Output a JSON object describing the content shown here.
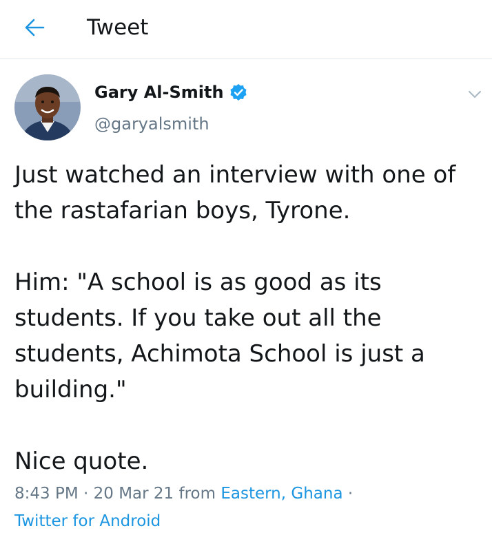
{
  "header": {
    "title": "Tweet",
    "back_icon": "arrow-left-icon"
  },
  "author": {
    "name": "Gary Al-Smith",
    "handle": "@garyalsmith",
    "verified_icon": "verified-badge-icon",
    "menu_icon": "chevron-down-icon"
  },
  "tweet": {
    "paragraphs": [
      "Just watched an interview with one of the rastafarian boys, Tyrone.",
      "Him: \"A school is as good as its students. If you take out all the students, Achimota School is just a building.\"",
      "Nice quote."
    ]
  },
  "meta": {
    "time": "8:43 PM",
    "separator_1": " · ",
    "date": "20 Mar 21",
    "from_text": " from ",
    "location": "Eastern, Ghana",
    "separator_2": " ·",
    "source": "Twitter for Android"
  },
  "colors": {
    "accent": "#1b95e0",
    "secondary_text": "#657786",
    "primary_text": "#14171a",
    "divider": "#e1e8ed"
  }
}
